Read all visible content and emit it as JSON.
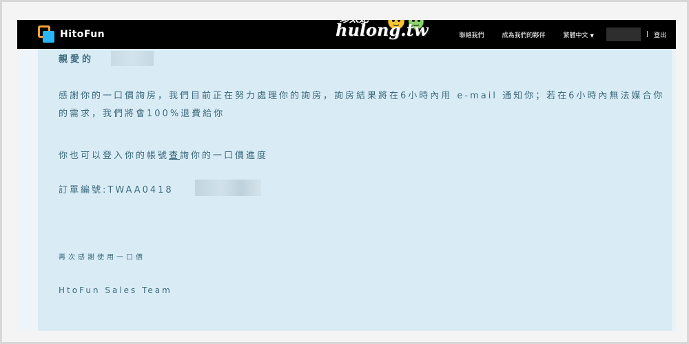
{
  "navbar": {
    "brand": "HitoFun",
    "menu": {
      "contact": "聯絡我們",
      "partner": "成為我們的夥伴",
      "language": "繁體中文",
      "separator": "|",
      "logout": "登出"
    },
    "colors": {
      "background": "#000000",
      "text": "#ffffff",
      "logo_orange": "#f3a23a",
      "logo_blue": "#29b6f6"
    }
  },
  "watermark": {
    "title": "珍太妃",
    "url": "hulong.tw"
  },
  "email": {
    "greeting": "親愛的",
    "body": "感謝你的一口價詢房，我們目前正在努力處理你的詢房，詢房結果將在6小時內用 e-mail 通知你；若在6小時內無法媒合你的需求，我們將會100%退費給你",
    "inquiry_prefix": "你也可以登入你的帳號",
    "inquiry_link": "查",
    "inquiry_suffix": "詢你的一口價進度",
    "order_label": "訂單編號:TWAA0418",
    "thanks": "再次感謝使用一口價",
    "signature": "HtoFun Sales Team",
    "colors": {
      "background": "#d9ecf6",
      "text": "#3d6a7c"
    }
  },
  "icons": [
    "hitofun-logo-icon",
    "caret-down-icon",
    "tiger-mascot-icon",
    "dinosaur-mascot-icon"
  ]
}
